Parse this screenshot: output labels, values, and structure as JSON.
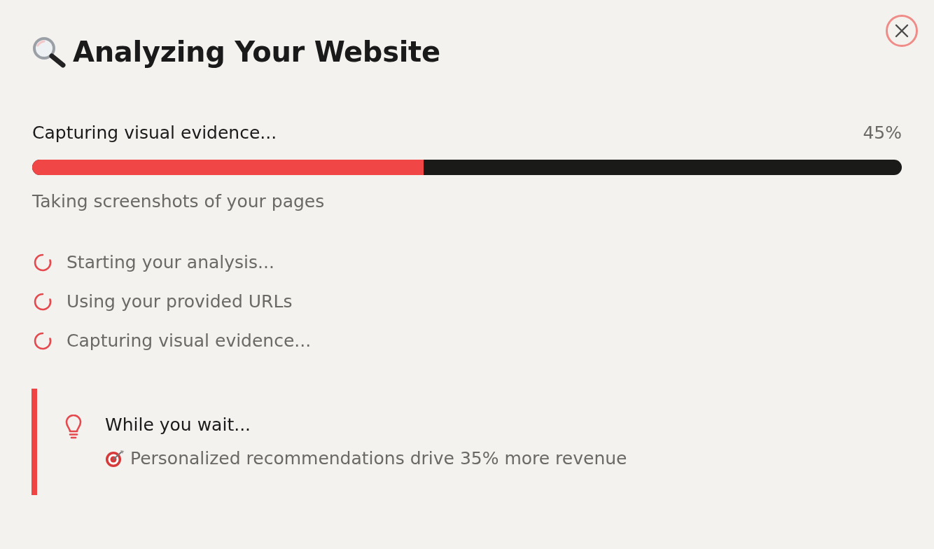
{
  "dialog": {
    "title": "Analyzing Your Website"
  },
  "progress": {
    "label": "Capturing visual evidence...",
    "percent": "45%",
    "level": 0.45,
    "detail": "Taking screenshots of your pages"
  },
  "steps": [
    {
      "label": "Starting your analysis..."
    },
    {
      "label": "Using your provided URLs"
    },
    {
      "label": "Capturing visual evidence..."
    }
  ],
  "tip": {
    "heading": "While you wait...",
    "text": "Personalized recommendations drive 35% more revenue"
  }
}
